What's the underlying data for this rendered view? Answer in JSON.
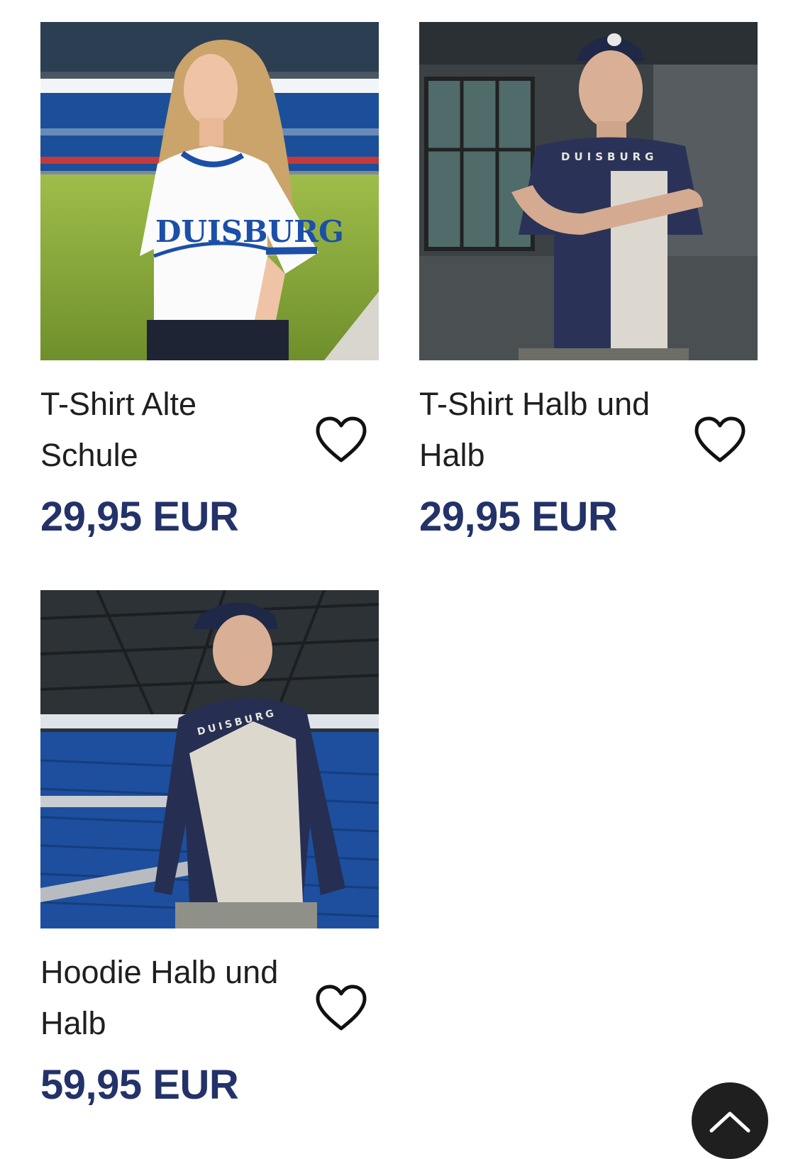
{
  "products": [
    {
      "title": "T-Shirt Alte Schule",
      "price": "29,95 EUR",
      "shirt_print": "DUISBURG",
      "image_alt": "T-Shirt Alte Schule"
    },
    {
      "title": "T-Shirt Halb und Halb",
      "price": "29,95 EUR",
      "shirt_print": "DUISBURG",
      "image_alt": "T-Shirt Halb und Halb"
    },
    {
      "title": "Hoodie Halb und Halb",
      "price": "59,95 EUR",
      "shirt_print": "DUISBURG",
      "image_alt": "Hoodie Halb und Halb"
    }
  ],
  "icons": {
    "wishlist": "heart-outline-icon",
    "scroll_top": "chevron-up-icon"
  },
  "colors": {
    "price": "#233268",
    "title": "#1f1f1f",
    "scroll_button": "#1f1f1f"
  }
}
